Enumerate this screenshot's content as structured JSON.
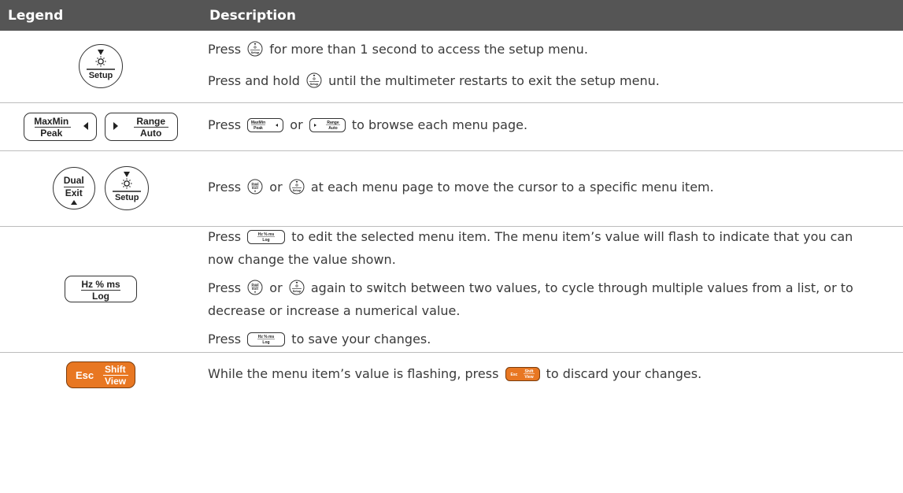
{
  "header": {
    "col_legend": "Legend",
    "col_description": "Description"
  },
  "keys": {
    "setup": {
      "label": "Setup"
    },
    "maxmin": {
      "top": "MaxMin",
      "bottom": "Peak"
    },
    "range": {
      "top": "Range",
      "bottom": "Auto"
    },
    "dual": {
      "top": "Dual",
      "bottom": "Exit"
    },
    "hz": {
      "top": "Hz % ms",
      "bottom": "Log"
    },
    "esc": {
      "left": "Esc",
      "top": "Shift",
      "bottom": "View"
    }
  },
  "rows": [
    {
      "lines": [
        {
          "a": "Press",
          "b": "for more than 1 second to access the setup menu."
        },
        {
          "a": "Press and hold",
          "b": "until the multimeter restarts to exit the setup menu."
        }
      ]
    },
    {
      "a": "Press",
      "or": "or",
      "b": "to browse each menu page."
    },
    {
      "a": "Press",
      "or": "or",
      "b": "at each menu page to move the cursor to a specific menu item."
    },
    {
      "lines": [
        {
          "a": "Press",
          "b": "to edit the selected menu item. The menu item’s value will flash to indicate that you can now change the value shown."
        },
        {
          "a": "Press",
          "or": "or",
          "b": "again to switch between two values, to cycle through multiple values from a list, or to decrease or increase a numerical value."
        },
        {
          "a": "Press",
          "b": "to save your changes."
        }
      ]
    },
    {
      "a": "While the menu item’s value is flashing, press",
      "b": "to discard your changes."
    }
  ]
}
